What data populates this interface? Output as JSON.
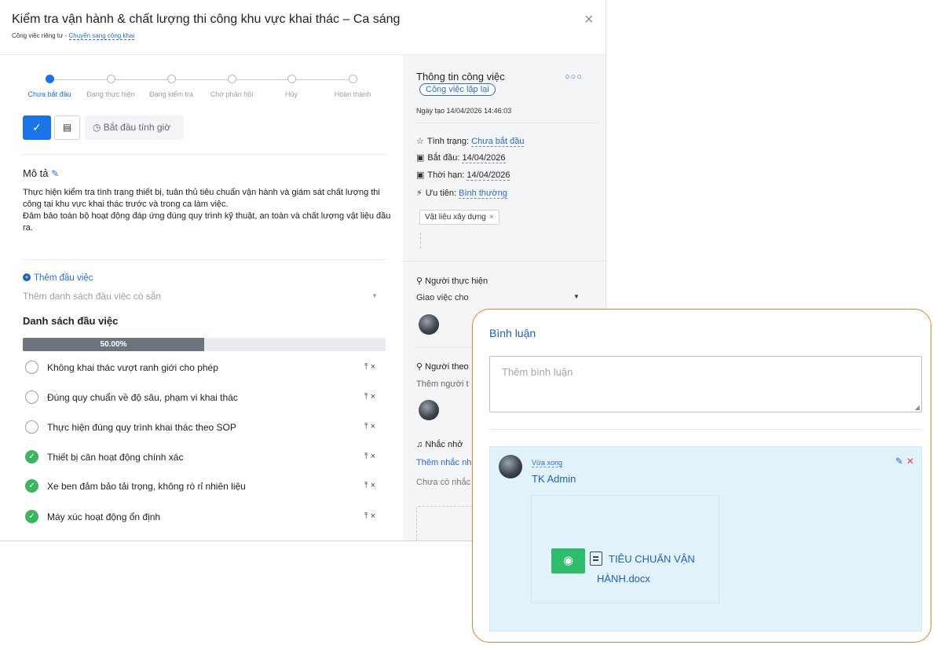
{
  "header": {
    "title": "Kiểm tra vận hành & chất lượng thi công khu vực khai thác – Ca sáng",
    "subtitle_prefix": "Công việc riêng tư - ",
    "subtitle_link": "Chuyển sang công khai",
    "close_icon": "×"
  },
  "steps": [
    {
      "label": "Chưa bắt đầu",
      "active": true
    },
    {
      "label": "Đang thực hiện",
      "active": false
    },
    {
      "label": "Đang kiểm tra",
      "active": false
    },
    {
      "label": "Chờ phản hồi",
      "active": false
    },
    {
      "label": "Hủy",
      "active": false
    },
    {
      "label": "Hoàn thành",
      "active": false
    }
  ],
  "toolbar": {
    "check_icon": "✓",
    "list_icon": "▤",
    "timer_label": "◷ Bắt đầu tính giờ"
  },
  "description": {
    "title": "Mô tả",
    "edit_icon": "✎",
    "line1": "Thực hiện kiểm tra tình trạng thiết bị, tuân thủ tiêu chuẩn vận hành và giám sát chất lượng thi công tại khu vực khai thác trước và trong ca làm việc.",
    "line2": "Đảm bảo toàn bộ hoạt động đáp ứng đúng quy trình kỹ thuật, an toàn và chất lượng vật liệu đầu ra."
  },
  "tasks_section": {
    "add_label": "Thêm đầu việc",
    "select_placeholder": "Thêm danh sách đầu việc có sẵn",
    "list_title": "Danh sách đầu việc",
    "progress_label": "50.00%",
    "progress_value": 0.5,
    "actions": "⤒×",
    "items": [
      {
        "text": "Không khai thác vượt ranh giới cho phép",
        "done": false
      },
      {
        "text": "Đúng quy chuẩn về độ sâu, phạm vi khai thác",
        "done": false
      },
      {
        "text": "Thực hiện đúng quy trình khai thác theo SOP",
        "done": false
      },
      {
        "text": "Thiết bị cân hoạt động chính xác",
        "done": true
      },
      {
        "text": "Xe ben đảm bảo tải trọng, không rò rỉ nhiên liệu",
        "done": true
      },
      {
        "text": "Máy xúc hoạt động ổn định",
        "done": true
      }
    ]
  },
  "info": {
    "title": "Thông tin công việc",
    "more_icon": "○○○",
    "badge": "Công việc lặp lại",
    "created": "Ngày tạo 14/04/2026 14:46:03",
    "status_label": "Tình trạng: ",
    "status_value": "Chưa bắt đầu",
    "start_label": "Bắt đầu: ",
    "start_value": "14/04/2026",
    "deadline_label": "Thời hạn: ",
    "deadline_value": "14/04/2026",
    "priority_label": "Ưu tiên: ",
    "priority_value": "Bình thường",
    "tag": "Vật liệu xây dựng",
    "assignee_label": "Người thực hiện",
    "assign_placeholder": "Giao việc cho",
    "follower_label": "Người theo",
    "follower_sub": "Thêm người t",
    "reminder_label": "Nhắc nhở",
    "reminder_add": "Thêm nhắc nh",
    "reminder_none": "Chưa có nhắc"
  },
  "comments": {
    "title": "Bình luận",
    "placeholder": "Thêm bình luận",
    "item": {
      "time": "Vừa xong",
      "author": "TK Admin",
      "file_line1": "TIÊU CHUẨN VẬN",
      "file_line2": "HÀNH.docx"
    }
  },
  "colors": {
    "accent": "#1a73e8",
    "done": "#3cb55f",
    "highlight_border": "#e8812f"
  }
}
